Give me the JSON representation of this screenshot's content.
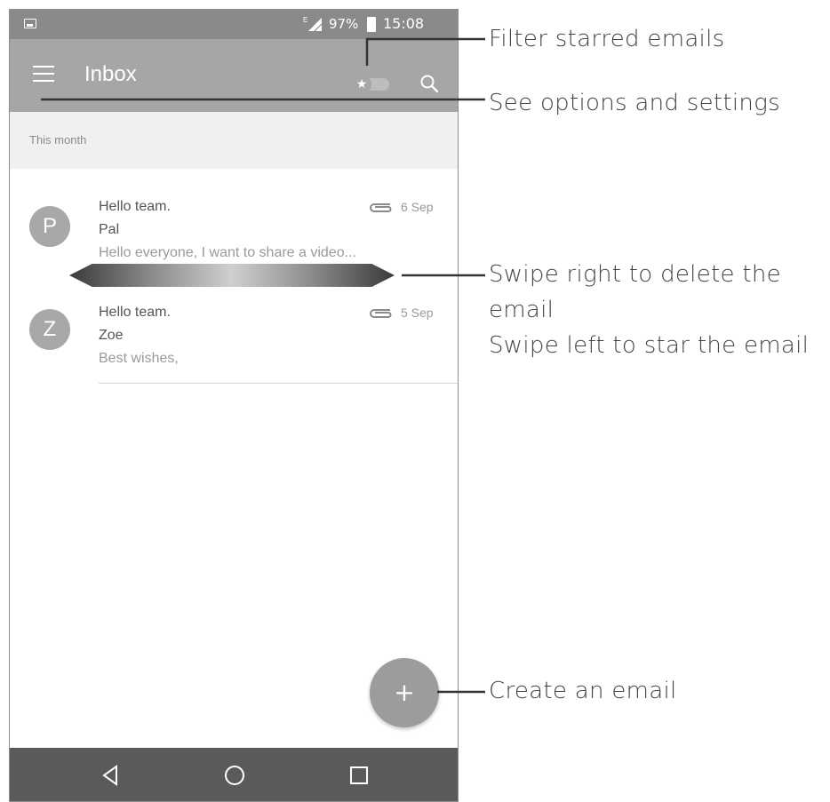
{
  "status_bar": {
    "network_label": "E",
    "battery_percent": "97%",
    "time": "15:08"
  },
  "app_bar": {
    "title": "Inbox",
    "menu_icon": "hamburger-menu-icon",
    "star_filter_icon": "star-toggle-icon",
    "search_icon": "search-icon"
  },
  "inbox": {
    "section_label": "This month",
    "emails": [
      {
        "avatar_letter": "P",
        "subject": "Hello team.",
        "sender": "Pal",
        "preview": "Hello everyone, I want to share a video...",
        "date": "6 Sep",
        "has_attachment": true
      },
      {
        "avatar_letter": "Z",
        "subject": "Hello team.",
        "sender": "Zoe",
        "preview": "Best wishes,",
        "date": "5 Sep",
        "has_attachment": true
      }
    ]
  },
  "fab": {
    "label": "+"
  },
  "nav_bar": {
    "back_icon": "back-triangle-icon",
    "home_icon": "home-circle-icon",
    "recents_icon": "recents-square-icon"
  },
  "callouts": {
    "filter_starred": "Filter starred emails",
    "options_settings": "See options and settings",
    "swipe_right_line1": "Swipe right to delete the",
    "swipe_right_line2": "email",
    "swipe_left": "Swipe left to star the email",
    "create_email": "Create an email"
  },
  "colors": {
    "status_bar": "#8a8a8a",
    "app_bar": "#a6a6a6",
    "nav_bar": "#5a5a5a",
    "avatar": "#a8a8a8",
    "fab": "#9c9c9c"
  }
}
